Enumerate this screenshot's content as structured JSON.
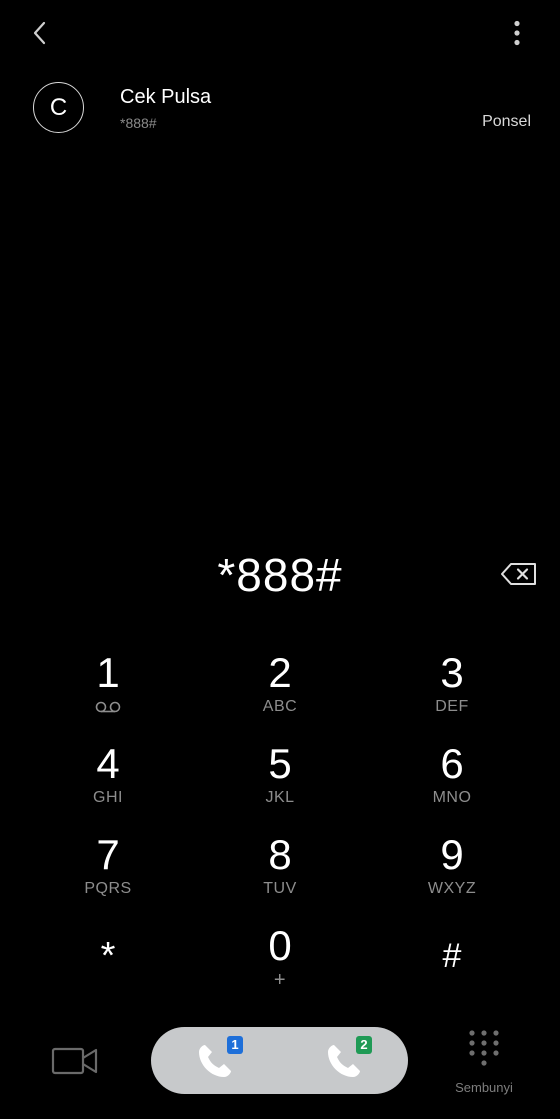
{
  "contact": {
    "avatar_letter": "C",
    "name": "Cek Pulsa",
    "number": "*888#",
    "type": "Ponsel"
  },
  "dialer": {
    "input_value": "*888#"
  },
  "keypad": {
    "k1": {
      "digit": "1",
      "sub": "voicemail-icon"
    },
    "k2": {
      "digit": "2",
      "letters": "ABC"
    },
    "k3": {
      "digit": "3",
      "letters": "DEF"
    },
    "k4": {
      "digit": "4",
      "letters": "GHI"
    },
    "k5": {
      "digit": "5",
      "letters": "JKL"
    },
    "k6": {
      "digit": "6",
      "letters": "MNO"
    },
    "k7": {
      "digit": "7",
      "letters": "PQRS"
    },
    "k8": {
      "digit": "8",
      "letters": "TUV"
    },
    "k9": {
      "digit": "9",
      "letters": "WXYZ"
    },
    "kstar": {
      "digit": "*"
    },
    "k0": {
      "digit": "0",
      "letters": "+"
    },
    "khash": {
      "digit": "#"
    }
  },
  "bottom": {
    "sim1_label": "1",
    "sim2_label": "2",
    "hide_label": "Sembunyi"
  },
  "icons": {
    "back": "chevron-left-icon",
    "more": "more-vertical-icon",
    "backspace": "backspace-icon",
    "video": "video-call-icon",
    "phone": "phone-icon",
    "hide": "dialpad-icon"
  },
  "colors": {
    "background": "#000000",
    "call_pill": "#c7c9cb",
    "sim1_badge": "#1e6fd9",
    "sim2_badge": "#1f9a55",
    "muted_text": "#8d8d8d"
  }
}
